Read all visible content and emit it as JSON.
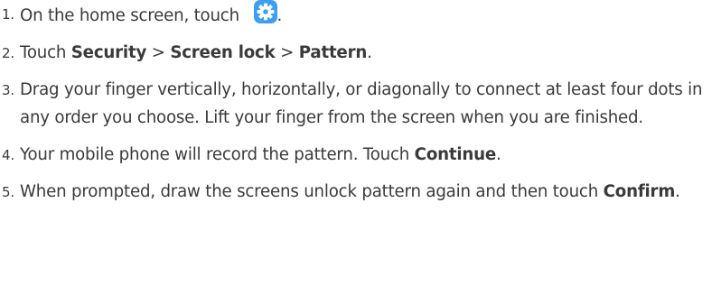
{
  "colors": {
    "text": "#3a3a3a",
    "settings_icon_bg": "#3e9ff0",
    "settings_icon_fg": "#ffffff"
  },
  "icons": {
    "settings": "settings-gear-icon"
  },
  "steps": [
    {
      "number": "1.",
      "text_before": "On the home screen, touch",
      "text_after": "."
    },
    {
      "number": "2.",
      "prefix": "Touch ",
      "item1": "Security",
      "sep1": " > ",
      "item2": "Screen lock",
      "sep2": " > ",
      "item3": "Pattern",
      "suffix": "."
    },
    {
      "number": "3.",
      "text": "Drag your finger vertically, horizontally, or diagonally to connect at least four dots in any order you choose. Lift your finger from the screen when you are finished."
    },
    {
      "number": "4.",
      "text": "Your mobile phone will record the pattern. Touch ",
      "bold": "Continue",
      "suffix": "."
    },
    {
      "number": "5.",
      "text": "When prompted, draw the screens unlock pattern again and then touch ",
      "bold": "Confirm",
      "suffix": "."
    }
  ]
}
